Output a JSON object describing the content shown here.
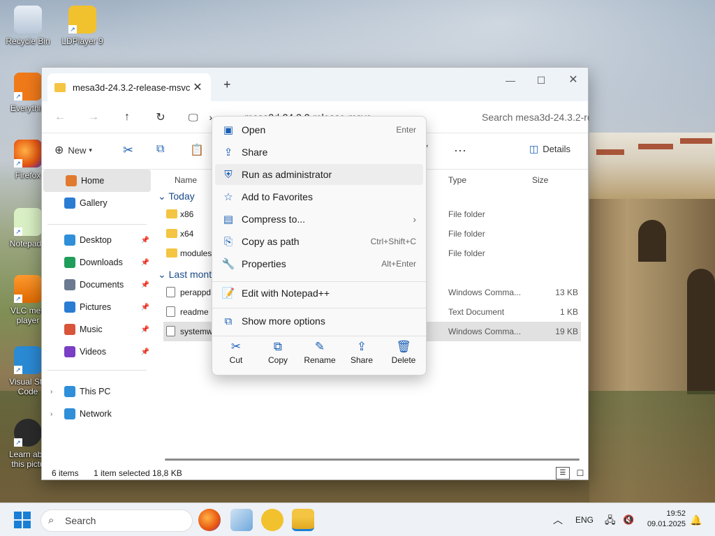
{
  "desktop": {
    "icons": [
      {
        "label": "Recycle Bin",
        "icon": "recycle-bin-icon"
      },
      {
        "label": "LDPlayer 9",
        "icon": "ldplayer-icon"
      },
      {
        "label": "Everythin",
        "icon": "everything-search-icon"
      },
      {
        "label": "Firefox",
        "icon": "firefox-icon"
      },
      {
        "label": "Notepad+",
        "icon": "notepad-plus-plus-icon"
      },
      {
        "label": "VLC med",
        "label2": "player",
        "icon": "vlc-icon"
      },
      {
        "label": "Visual Stu",
        "label2": "Code",
        "icon": "vscode-icon"
      },
      {
        "label": "Learn abo",
        "label2": "this pictu",
        "icon": "learn-picture-icon"
      }
    ]
  },
  "window": {
    "tab_title": "mesa3d-24.3.2-release-msvc",
    "new_tab": "+",
    "address": {
      "more": "···",
      "folder": "mesa3d-24.3.2-release-msvc"
    },
    "search_placeholder": "Search mesa3d-24.3.2-re",
    "toolbar": {
      "new_label": "New",
      "details_label": "Details"
    },
    "sidebar": {
      "items": [
        {
          "label": "Home",
          "icon": "home-icon",
          "color": "#e07a2e"
        },
        {
          "label": "Gallery",
          "icon": "gallery-icon",
          "color": "#2b7cd3"
        },
        {
          "label": "Desktop",
          "icon": "desktop-folder-icon",
          "color": "#2f8fd8"
        },
        {
          "label": "Downloads",
          "icon": "download-icon",
          "color": "#1e9e5a"
        },
        {
          "label": "Documents",
          "icon": "documents-icon",
          "color": "#6b7a8f"
        },
        {
          "label": "Pictures",
          "icon": "pictures-icon",
          "color": "#2b7cd3"
        },
        {
          "label": "Music",
          "icon": "music-icon",
          "color": "#d8553a"
        },
        {
          "label": "Videos",
          "icon": "videos-icon",
          "color": "#7a3fc4"
        },
        {
          "label": "This PC",
          "icon": "this-pc-icon",
          "color": "#2f8fd8"
        },
        {
          "label": "Network",
          "icon": "network-icon",
          "color": "#2f8fd8"
        }
      ]
    },
    "columns": {
      "name": "Name",
      "type": "Type",
      "size": "Size"
    },
    "groups": {
      "today": "Today",
      "last_month": "Last mont"
    },
    "files": [
      {
        "name": "x86",
        "type": "File folder",
        "size": "",
        "kind": "folder"
      },
      {
        "name": "x64",
        "type": "File folder",
        "size": "",
        "kind": "folder"
      },
      {
        "name": "modules",
        "type": "File folder",
        "size": "",
        "kind": "folder"
      },
      {
        "name": "perappd",
        "type": "Windows Comma...",
        "size": "13 KB",
        "kind": "cmd"
      },
      {
        "name": "readme",
        "type": "Text Document",
        "size": "1 KB",
        "kind": "doc"
      },
      {
        "name": "systemw",
        "type": "Windows Comma...",
        "size": "19 KB",
        "kind": "cmd"
      }
    ],
    "status": {
      "count": "6 items",
      "selected": "1 item selected",
      "size": "18,8 KB"
    }
  },
  "context_menu": {
    "items": [
      {
        "label": "Open",
        "shortcut": "Enter",
        "icon": "open-icon"
      },
      {
        "label": "Share",
        "shortcut": "",
        "icon": "share-icon"
      },
      {
        "label": "Run as administrator",
        "shortcut": "",
        "icon": "shield-icon"
      },
      {
        "label": "Add to Favorites",
        "shortcut": "",
        "icon": "star-icon"
      },
      {
        "label": "Compress to...",
        "shortcut": "",
        "icon": "zip-icon",
        "submenu": true
      },
      {
        "label": "Copy as path",
        "shortcut": "Ctrl+Shift+C",
        "icon": "copy-path-icon"
      },
      {
        "label": "Properties",
        "shortcut": "Alt+Enter",
        "icon": "wrench-icon"
      }
    ],
    "notepad": {
      "label": "Edit with Notepad++",
      "icon": "notepad-plus-plus-icon"
    },
    "more": {
      "label": "Show more options",
      "icon": "show-more-icon"
    },
    "quick_actions": [
      {
        "label": "Cut",
        "icon": "scissors-icon"
      },
      {
        "label": "Copy",
        "icon": "copy-icon"
      },
      {
        "label": "Rename",
        "icon": "rename-icon"
      },
      {
        "label": "Share",
        "icon": "share-icon"
      },
      {
        "label": "Delete",
        "icon": "trash-icon"
      }
    ]
  },
  "taskbar": {
    "search": "Search",
    "lang": "ENG",
    "time": "19:52",
    "date": "09.01.2025"
  }
}
